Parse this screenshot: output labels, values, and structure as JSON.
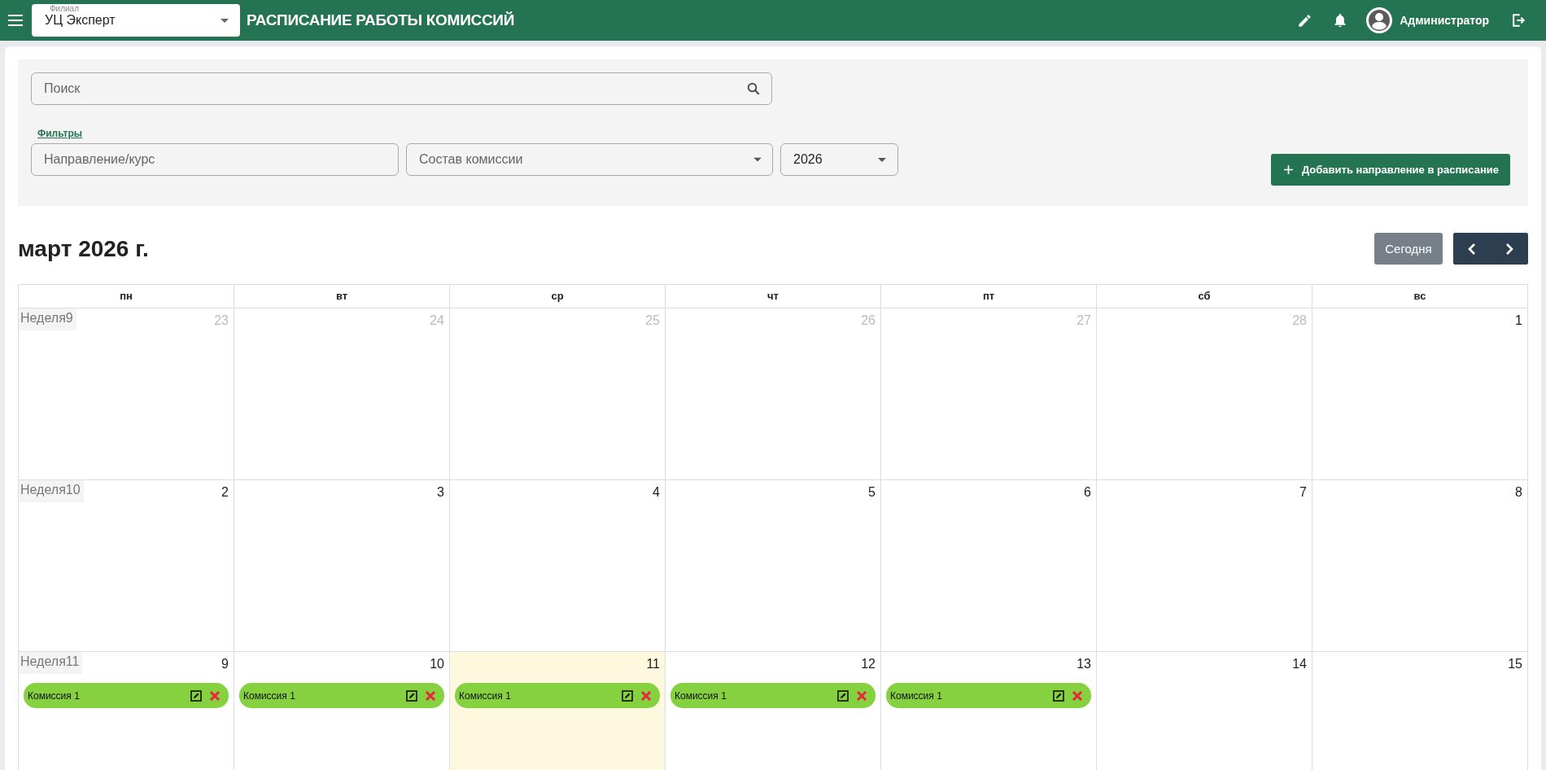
{
  "top_bar": {
    "branch_field": {
      "label": "Филиал",
      "value": "УЦ Эксперт"
    },
    "title": "РАСПИСАНИЕ РАБОТЫ КОМИССИЙ",
    "user": "Администратор"
  },
  "filters": {
    "search": {
      "placeholder": "Поиск"
    },
    "filters_link": "Фильтры",
    "direction": {
      "placeholder": "Направление/курс"
    },
    "commission": {
      "placeholder": "Состав комиссии"
    },
    "year": {
      "value": "2026"
    },
    "add_button": "Добавить направление в расписание"
  },
  "calendar": {
    "month_title": "март 2026 г.",
    "today_button": "Сегодня",
    "weekdays": [
      "пн",
      "вт",
      "ср",
      "чт",
      "пт",
      "сб",
      "вс"
    ],
    "weeks": [
      {
        "label": "Неделя9",
        "days": [
          {
            "number": "23",
            "other_month": true,
            "today": false
          },
          {
            "number": "24",
            "other_month": true,
            "today": false
          },
          {
            "number": "25",
            "other_month": true,
            "today": false
          },
          {
            "number": "26",
            "other_month": true,
            "today": false
          },
          {
            "number": "27",
            "other_month": true,
            "today": false
          },
          {
            "number": "28",
            "other_month": true,
            "today": false
          },
          {
            "number": "1",
            "other_month": false,
            "today": false
          }
        ]
      },
      {
        "label": "Неделя10",
        "days": [
          {
            "number": "2",
            "other_month": false,
            "today": false
          },
          {
            "number": "3",
            "other_month": false,
            "today": false
          },
          {
            "number": "4",
            "other_month": false,
            "today": false
          },
          {
            "number": "5",
            "other_month": false,
            "today": false
          },
          {
            "number": "6",
            "other_month": false,
            "today": false
          },
          {
            "number": "7",
            "other_month": false,
            "today": false
          },
          {
            "number": "8",
            "other_month": false,
            "today": false
          }
        ]
      },
      {
        "label": "Неделя11",
        "days": [
          {
            "number": "9",
            "other_month": false,
            "today": false,
            "events": [
              {
                "title": "Комиссия 1"
              }
            ]
          },
          {
            "number": "10",
            "other_month": false,
            "today": false,
            "events": [
              {
                "title": "Комиссия 1"
              }
            ]
          },
          {
            "number": "11",
            "other_month": false,
            "today": true,
            "events": [
              {
                "title": "Комиссия 1"
              }
            ]
          },
          {
            "number": "12",
            "other_month": false,
            "today": false,
            "events": [
              {
                "title": "Комиссия 1"
              }
            ]
          },
          {
            "number": "13",
            "other_month": false,
            "today": false,
            "events": [
              {
                "title": "Комиссия 1"
              }
            ]
          },
          {
            "number": "14",
            "other_month": false,
            "today": false
          },
          {
            "number": "15",
            "other_month": false,
            "today": false
          }
        ]
      }
    ]
  }
}
